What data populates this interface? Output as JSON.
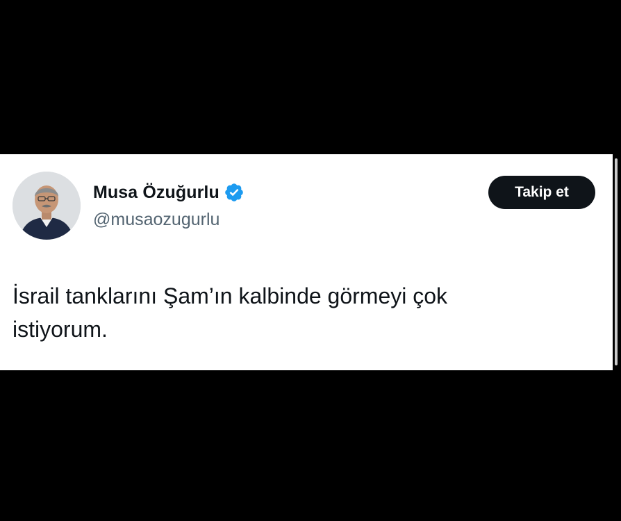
{
  "tweet": {
    "author": {
      "display_name": "Musa Özuğurlu",
      "handle": "@musaozugurlu",
      "verified_icon": "verified-badge-icon",
      "verified_color": "#1d9bf0",
      "avatar": "profile-photo"
    },
    "follow_button_label": "Takip et",
    "text_lines": [
      "İsrail tanklarını Şam’ın kalbinde görmeyi çok",
      "istiyorum."
    ]
  },
  "colors": {
    "background": "#000000",
    "card": "#ffffff",
    "text_primary": "#0f1419",
    "text_secondary": "#536471",
    "button_bg": "#0f1419"
  }
}
